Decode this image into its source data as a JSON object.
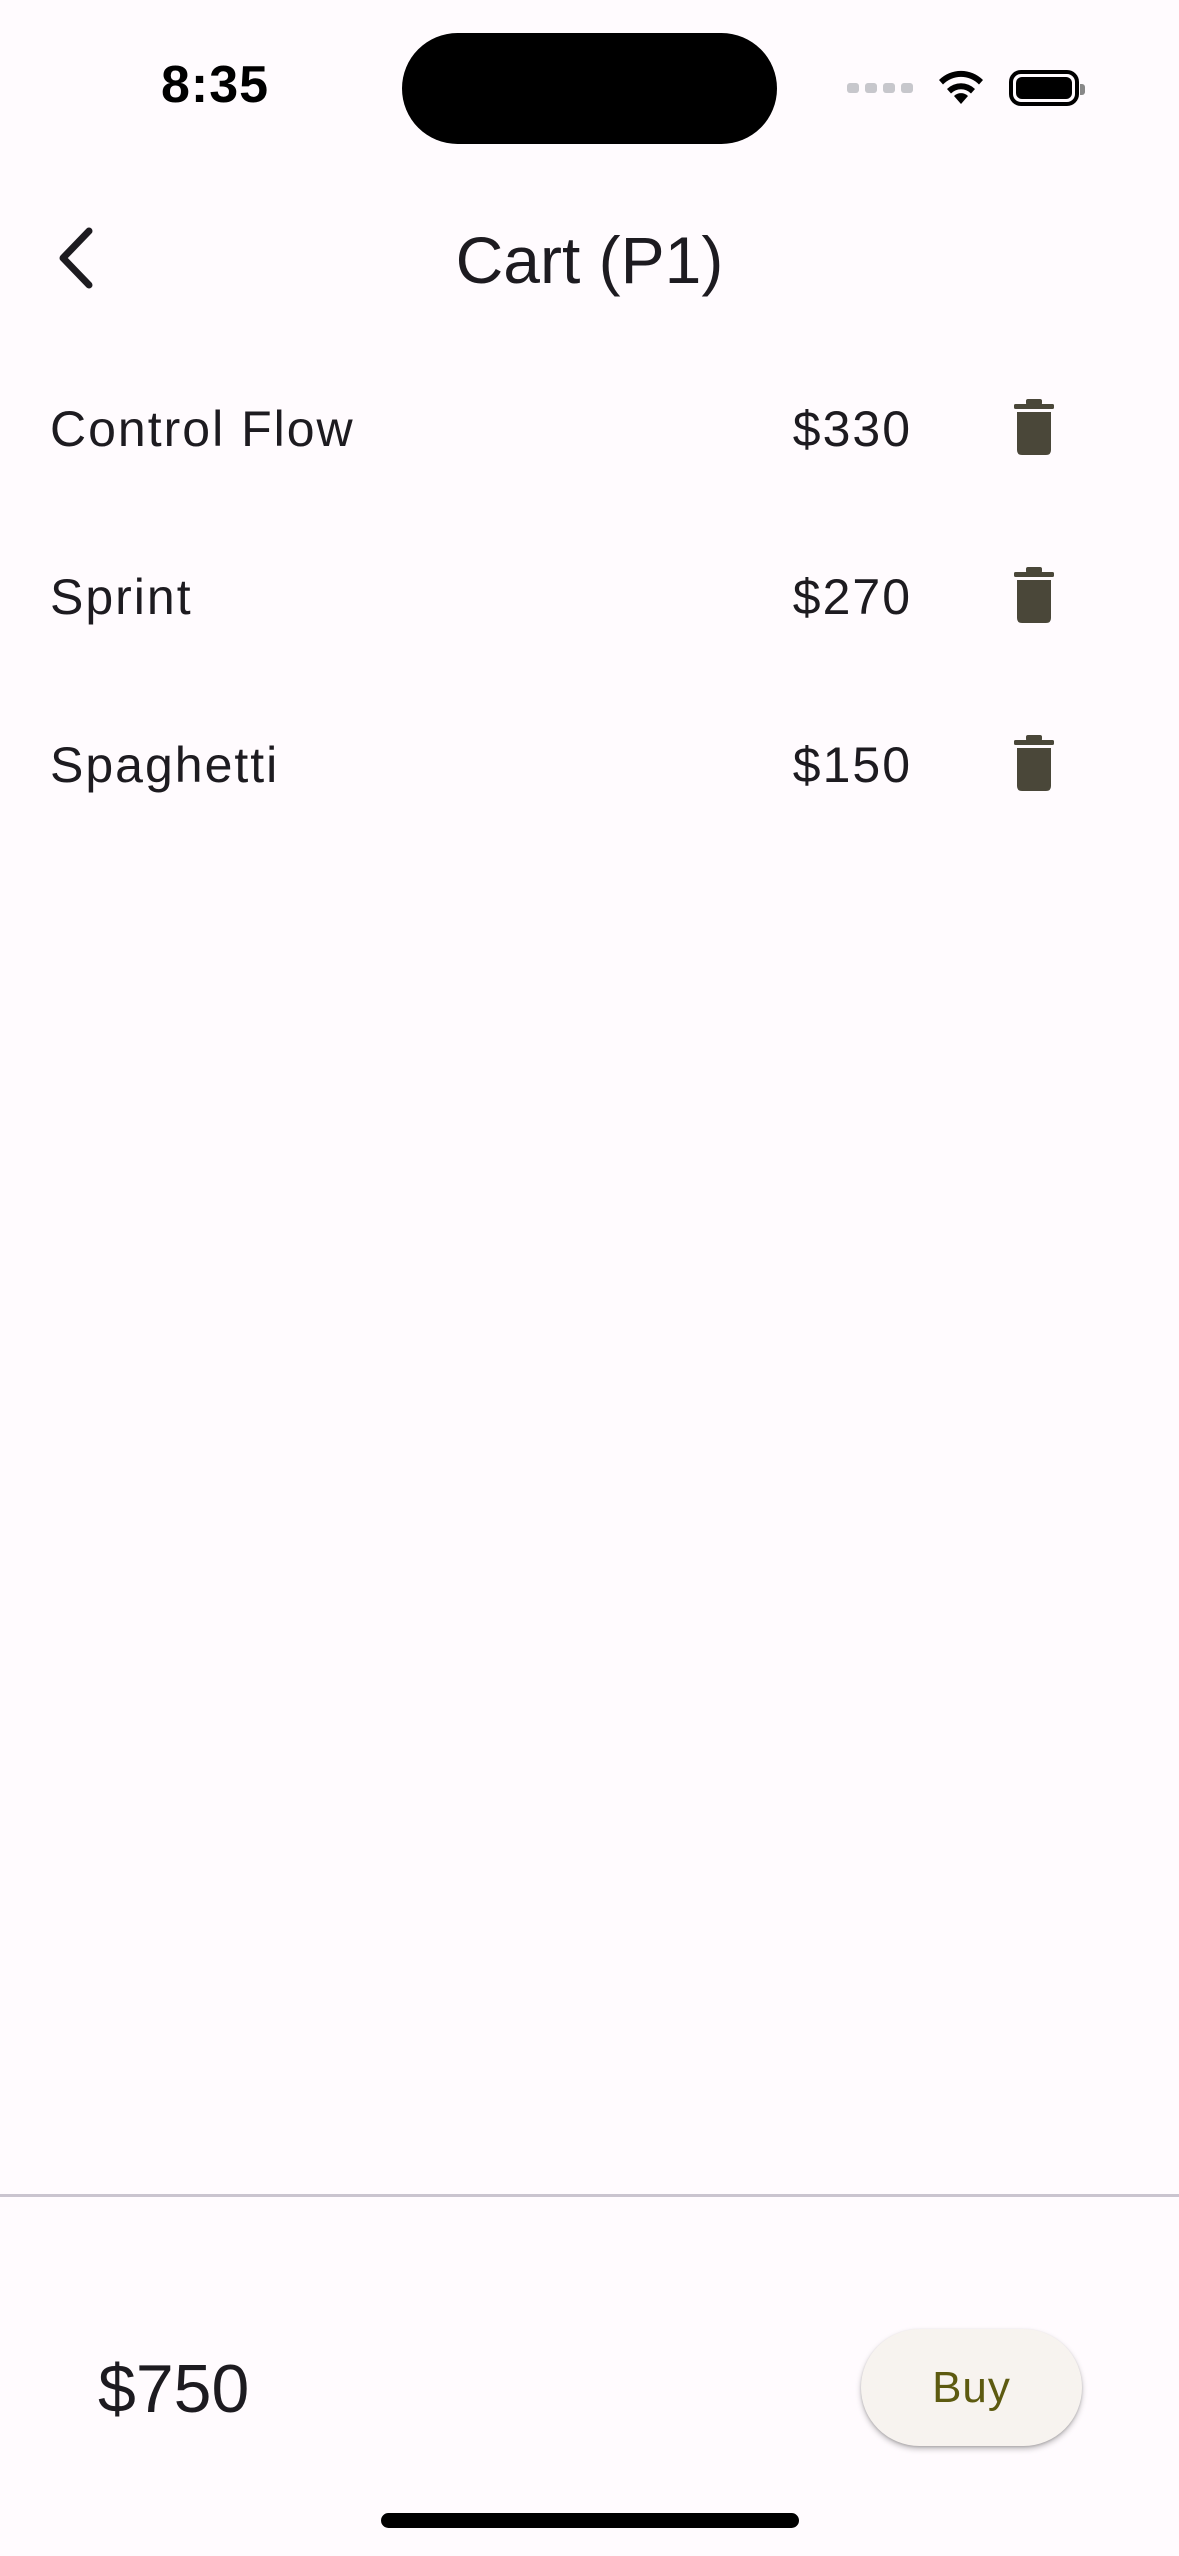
{
  "status_bar": {
    "time": "8:35"
  },
  "app_bar": {
    "title": "Cart (P1)",
    "back_icon": "chevron-left-icon"
  },
  "cart": {
    "items": [
      {
        "name": "Control Flow",
        "price": "$330",
        "delete_icon": "trash-icon"
      },
      {
        "name": "Sprint",
        "price": "$270",
        "delete_icon": "trash-icon"
      },
      {
        "name": "Spaghetti",
        "price": "$150",
        "delete_icon": "trash-icon"
      }
    ]
  },
  "footer": {
    "total": "$750",
    "buy_label": "Buy"
  },
  "colors": {
    "background": "#fffbfe",
    "text": "#1d1b20",
    "icon": "#4a4739",
    "buy_text": "#5d5a10",
    "buy_background": "#f7f3ef",
    "divider": "#cac4cf"
  }
}
